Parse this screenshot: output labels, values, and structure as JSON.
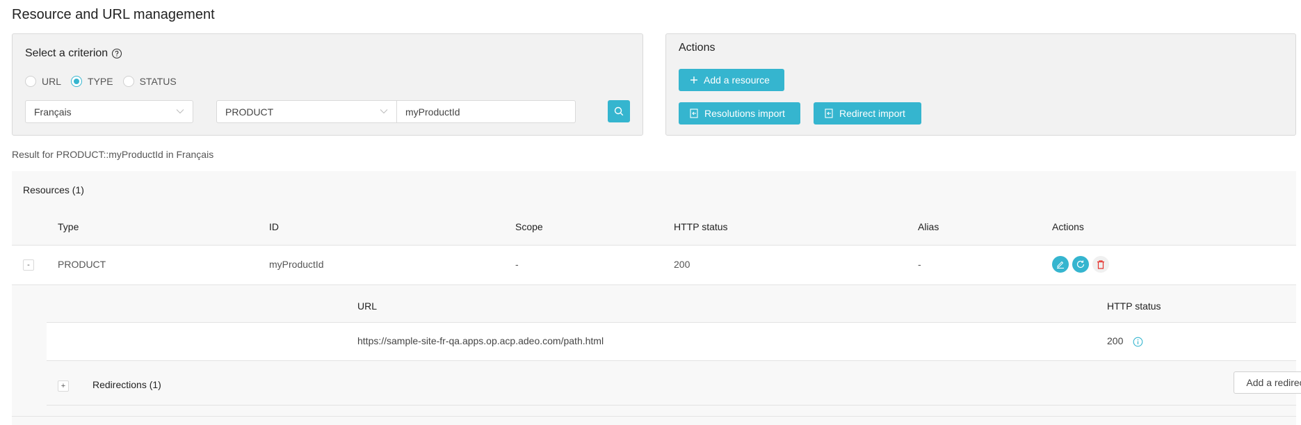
{
  "page": {
    "title": "Resource and URL management"
  },
  "criterion": {
    "title": "Select a criterion",
    "help_icon": "question-circle-icon",
    "radios": [
      {
        "label": "URL",
        "checked": false
      },
      {
        "label": "TYPE",
        "checked": true
      },
      {
        "label": "STATUS",
        "checked": false
      }
    ],
    "language_select": {
      "value": "Français"
    },
    "type_select": {
      "value": "PRODUCT"
    },
    "id_input": {
      "value": "myProductId"
    },
    "search_icon": "search-icon"
  },
  "actions": {
    "title": "Actions",
    "add_resource_label": "Add a resource",
    "resolutions_import_label": "Resolutions import",
    "redirect_import_label": "Redirect import"
  },
  "result_text": "Result for PRODUCT::myProductId in Français",
  "resources": {
    "title": "Resources (1)",
    "columns": [
      "Type",
      "ID",
      "Scope",
      "HTTP status",
      "Alias",
      "Actions"
    ],
    "rows": [
      {
        "toggle": "-",
        "type": "PRODUCT",
        "id": "myProductId",
        "scope": "-",
        "http_status": "200",
        "alias": "-",
        "actions": [
          "edit-icon",
          "refresh-icon",
          "delete-icon"
        ]
      }
    ],
    "urls": {
      "columns": [
        "URL",
        "HTTP status"
      ],
      "rows": [
        {
          "url": "https://sample-site-fr-qa.apps.op.acp.adeo.com/path.html",
          "http_status": "200"
        }
      ]
    },
    "redirections": {
      "toggle": "+",
      "title": "Redirections (1)",
      "add_label": "Add a redirect"
    }
  },
  "colors": {
    "accent": "#35b5cf",
    "danger": "#e5322d",
    "panel_bg": "#f2f2f2"
  }
}
